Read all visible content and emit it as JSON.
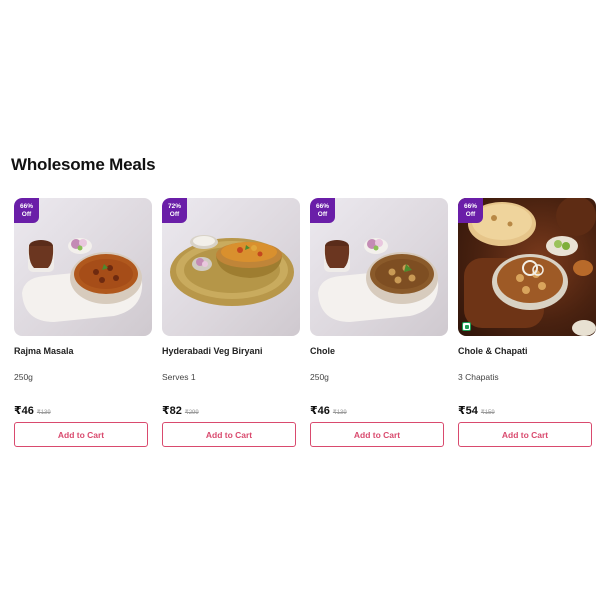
{
  "section": {
    "title": "Wholesome Meals"
  },
  "products": [
    {
      "discount": "66%",
      "off_label": "Off",
      "name": "Rajma Masala",
      "quantity": "250g",
      "price": "₹46",
      "mrp": "₹139",
      "cart_label": "Add to Cart",
      "veg_mark": false
    },
    {
      "discount": "72%",
      "off_label": "Off",
      "name": "Hyderabadi Veg Biryani",
      "quantity": "Serves 1",
      "price": "₹82",
      "mrp": "₹299",
      "cart_label": "Add to Cart",
      "veg_mark": false
    },
    {
      "discount": "66%",
      "off_label": "Off",
      "name": "Chole",
      "quantity": "250g",
      "price": "₹46",
      "mrp": "₹139",
      "cart_label": "Add to Cart",
      "veg_mark": false
    },
    {
      "discount": "66%",
      "off_label": "Off",
      "name": "Chole & Chapati",
      "quantity": "3 Chapatis",
      "price": "₹54",
      "mrp": "₹159",
      "cart_label": "Add to Cart",
      "veg_mark": true
    }
  ],
  "colors": {
    "badge": "#6a1ea8",
    "cart_button": "#d94a6e",
    "veg_mark": "#1f9d55"
  }
}
